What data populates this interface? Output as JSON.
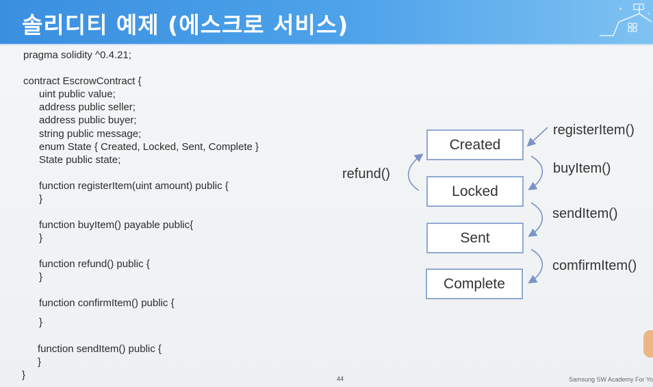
{
  "header": {
    "title": "솔리디티 예제 (에스크로 서비스)"
  },
  "code_lines": [
    "pragma solidity ^0.4.21;",
    "contract EscrowContract {",
    "uint public value;",
    "address public seller;",
    "address public buyer;",
    "string public message;",
    "enum State { Created, Locked, Sent, Complete }",
    "State public state;",
    "function registerItem(uint amount) public {",
    "}",
    "function buyItem() payable public{",
    "}",
    "function refund() public {",
    "}",
    "function confirmItem() public {",
    "}",
    "function sendItem() public {",
    "}",
    "}"
  ],
  "diagram": {
    "states": [
      "Created",
      "Locked",
      "Sent",
      "Complete"
    ],
    "transitions": {
      "register": "registerItem()",
      "buy": "buyItem()",
      "send": "sendItem()",
      "confirm": "comfirmItem()",
      "refund": "refund()"
    }
  },
  "footer": {
    "page_number": "44",
    "credit": "Samsung SW Academy For Yo"
  },
  "colors": {
    "header_blue": "#3a8fe0",
    "box_border": "#8fa9d2",
    "arrow": "#7b93c8"
  }
}
